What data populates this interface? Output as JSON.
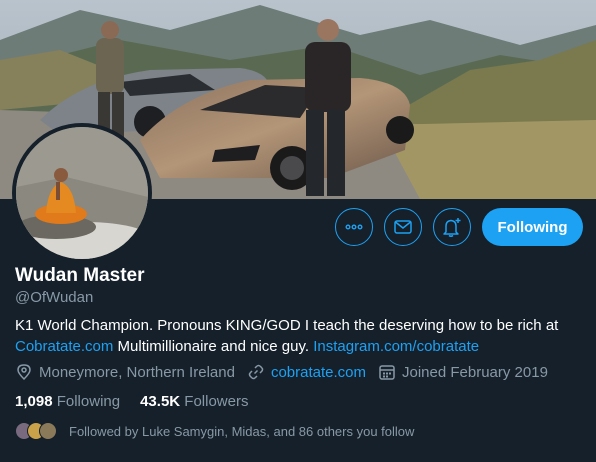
{
  "profile": {
    "name": "Wudan Master",
    "handle": "@OfWudan",
    "bio_text_1": "K1 World Champion. Pronouns KING/GOD I teach the deserving how to be rich at ",
    "bio_link_1": "Cobratate.com",
    "bio_text_2": " Multimillionaire and nice guy. ",
    "bio_link_2": "Instagram.com/cobratate",
    "location": "Moneymore, Northern Ireland",
    "website": "cobratate.com",
    "joined": "Joined February 2019"
  },
  "stats": {
    "following_count": "1,098",
    "following_label": "Following",
    "followers_count": "43.5K",
    "followers_label": "Followers"
  },
  "followed_by": "Followed by Luke Samygin, Midas, and 86 others you follow",
  "actions": {
    "follow_label": "Following",
    "more_icon": "more-dots-icon",
    "message_icon": "envelope-icon",
    "notify_icon": "bell-plus-icon"
  },
  "colors": {
    "background": "#15202b",
    "accent": "#1da1f2",
    "secondary_text": "#8899a6"
  }
}
